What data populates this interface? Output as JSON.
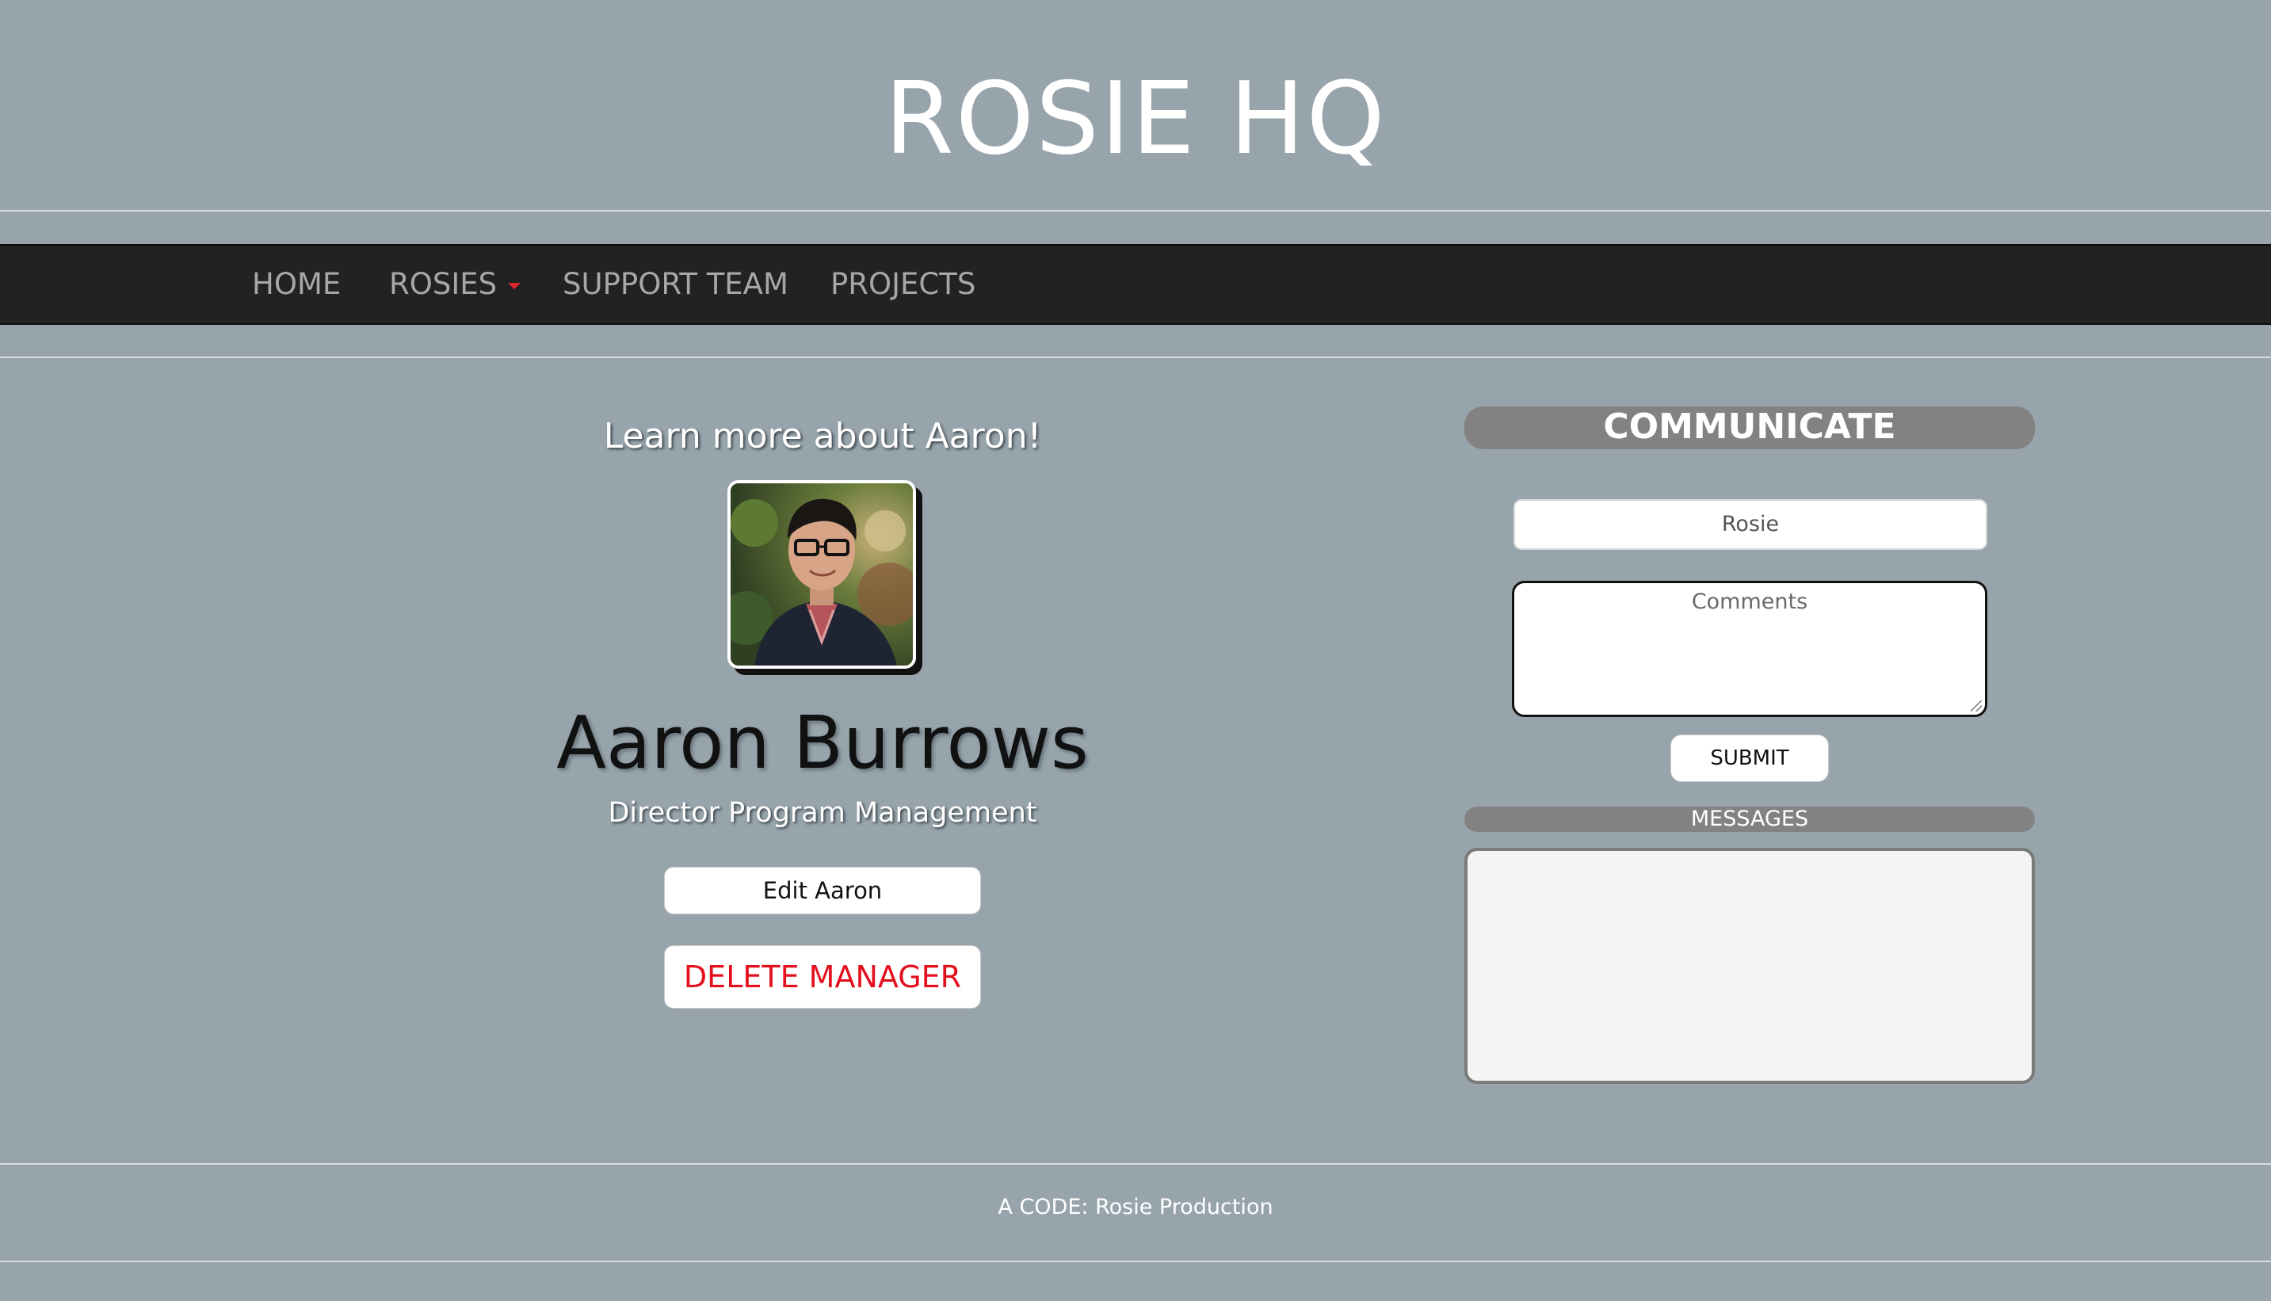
{
  "site": {
    "title": "ROSIE HQ"
  },
  "nav": {
    "items": [
      {
        "label": "HOME"
      },
      {
        "label": "ROSIES",
        "has_dropdown": true
      },
      {
        "label": "SUPPORT TEAM"
      },
      {
        "label": "PROJECTS"
      }
    ]
  },
  "profile": {
    "learn_more": "Learn more about Aaron!",
    "name": "Aaron Burrows",
    "job_title": "Director Program Management",
    "edit_label": "Edit Aaron",
    "delete_label": "DELETE MANAGER"
  },
  "communicate": {
    "header": "COMMUNICATE",
    "name_value": "Rosie",
    "comments_placeholder": "Comments",
    "submit_label": "SUBMIT",
    "messages_header": "MESSAGES"
  },
  "footer": {
    "text": "A CODE: Rosie Production"
  },
  "colors": {
    "page_background": "#97a4ac",
    "navbar_background": "#222222",
    "nav_text": "#a7a7a7",
    "dropdown_caret": "#e0262b",
    "delete_text": "#e30f1d",
    "pill_header": "#828282"
  }
}
